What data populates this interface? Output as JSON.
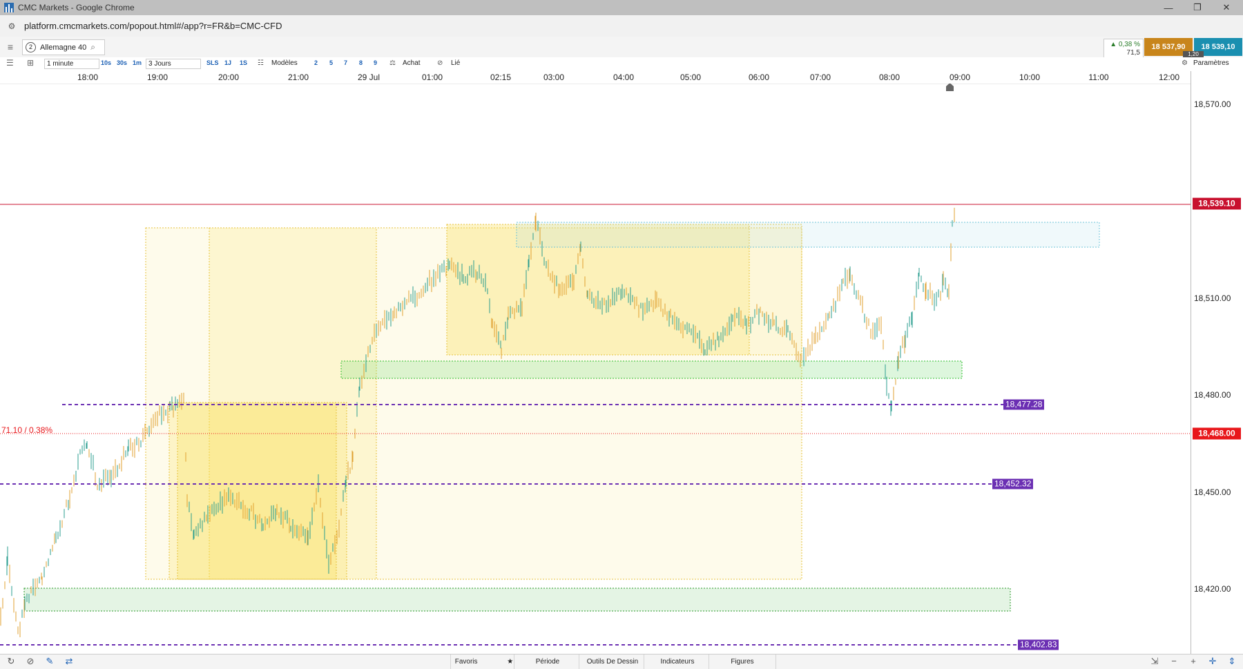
{
  "window": {
    "title": "CMC Markets - Google Chrome",
    "url": "platform.cmcmarkets.com/popout.html#/app?r=FR&b=CMC-CFD"
  },
  "instrument": {
    "index": "2",
    "name": "Allemagne 40",
    "change_pct": "▲ 0,38 %",
    "change_pts": "71,5",
    "sell": "18 537,90",
    "buy": "18 539,10",
    "spread": "1,20"
  },
  "toolbar": {
    "interval": "1 minute",
    "tf_10s": "10s",
    "tf_30s": "30s",
    "tf_1m": "1m",
    "range": "3 Jours",
    "sls": "SLS",
    "tf_1j": "1J",
    "tf_1s": "1S",
    "templates": "Modèles",
    "n2": "2",
    "n5": "5",
    "n7": "7",
    "n8": "8",
    "n9": "9",
    "buy": "Achat",
    "linked": "Lié",
    "settings": "Paramètres"
  },
  "time_labels": [
    "18:00",
    "19:00",
    "20:00",
    "21:00",
    "29 Jul",
    "01:00",
    "02:15",
    "03:00",
    "04:00",
    "05:00",
    "06:00",
    "07:00",
    "08:00",
    "09:00",
    "10:00",
    "11:00",
    "12:00"
  ],
  "price_ticks": [
    "18,570.00",
    "18,510.00",
    "18,480.00",
    "18,450.00",
    "18,420.00"
  ],
  "current_price": "18,539.10",
  "ref_price": "18,468.00",
  "ref_change": "71.10 / 0.38%",
  "levels": [
    {
      "label": "18,477.28"
    },
    {
      "label": "18,452.32"
    },
    {
      "label": "18,402.83"
    }
  ],
  "bottom": {
    "favorites": "Favoris",
    "period": "Période",
    "drawing_tools": "Outils De Dessin",
    "indicators": "Indicateurs",
    "figures": "Figures"
  },
  "colors": {
    "current_price": "#c8102e",
    "ref_price": "#e8171b",
    "level": "#6b2fb3",
    "sell": "#c8851b",
    "buy": "#1a8fb0",
    "candle_up": "#2a9d8f",
    "candle_down": "#e0a030"
  }
}
